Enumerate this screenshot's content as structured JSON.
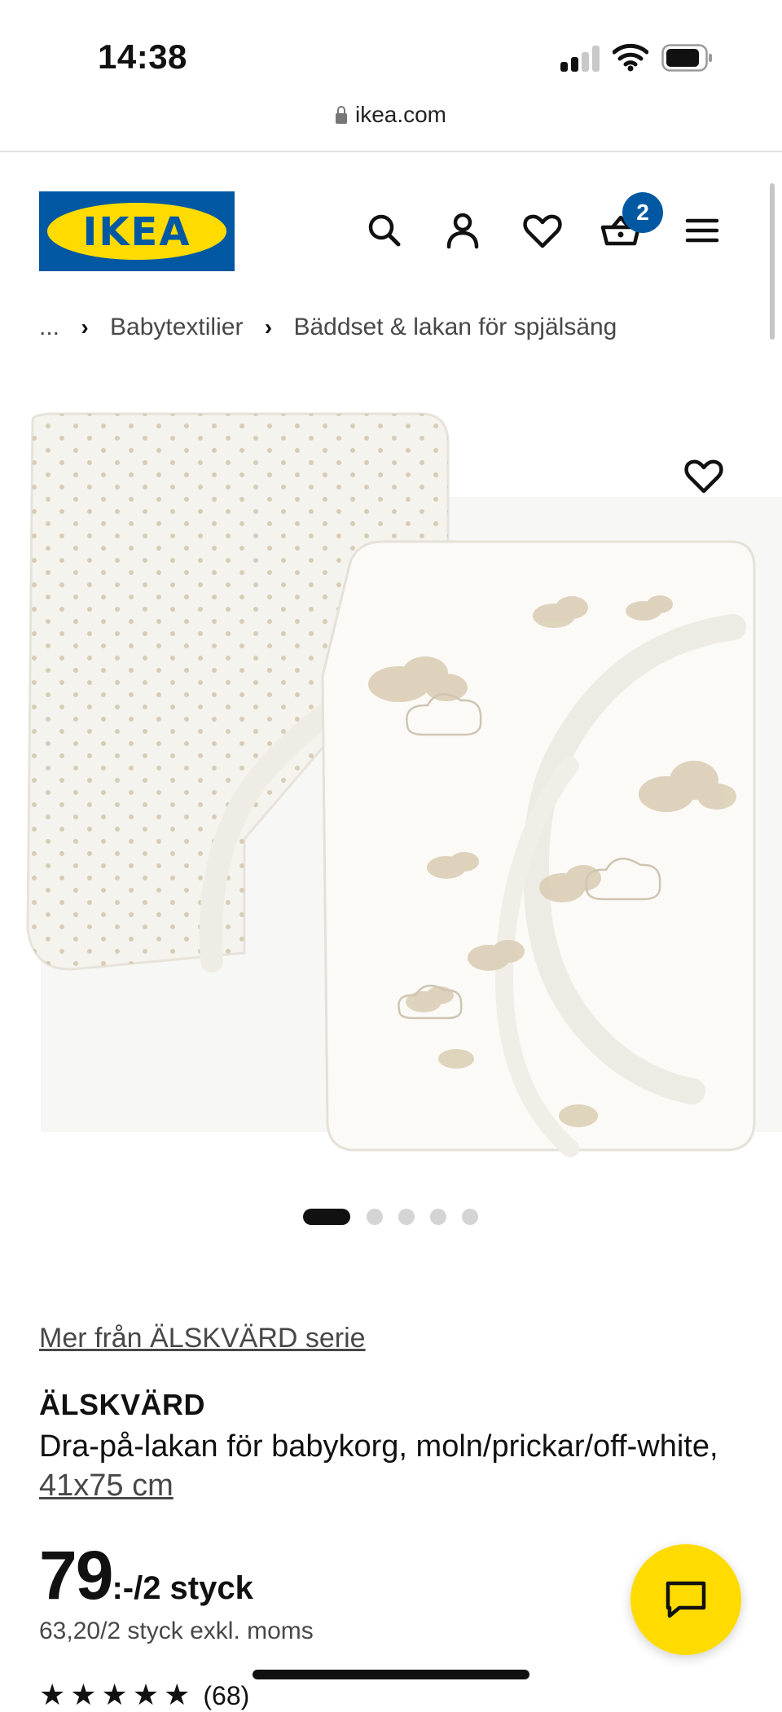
{
  "status_bar": {
    "time": "14:38"
  },
  "browser": {
    "url": "ikea.com"
  },
  "header": {
    "logo_text": "IKEA",
    "cart_count": "2",
    "brand_colors": {
      "blue": "#0058a3",
      "yellow": "#ffdb00"
    },
    "icons": [
      "search-icon",
      "account-icon",
      "favorites-icon",
      "cart-icon",
      "menu-icon"
    ]
  },
  "breadcrumb": {
    "ellipsis": "...",
    "items": [
      "Babytextilier",
      "Bäddset & lakan för spjälsäng"
    ]
  },
  "carousel": {
    "total": 5,
    "active_index": 0
  },
  "product": {
    "series_link": "Mer från ÄLSKVÄRD serie",
    "name": "ÄLSKVÄRD",
    "description": "Dra-på-lakan för babykorg, moln/prickar/off-white, ",
    "size": "41x75 cm",
    "price_main": "79",
    "price_suffix": ":-/2 styck",
    "price_excl_vat": "63,20/2 styck exkl. moms",
    "rating_stars": "★★★★★",
    "rating_count": "(68)"
  }
}
